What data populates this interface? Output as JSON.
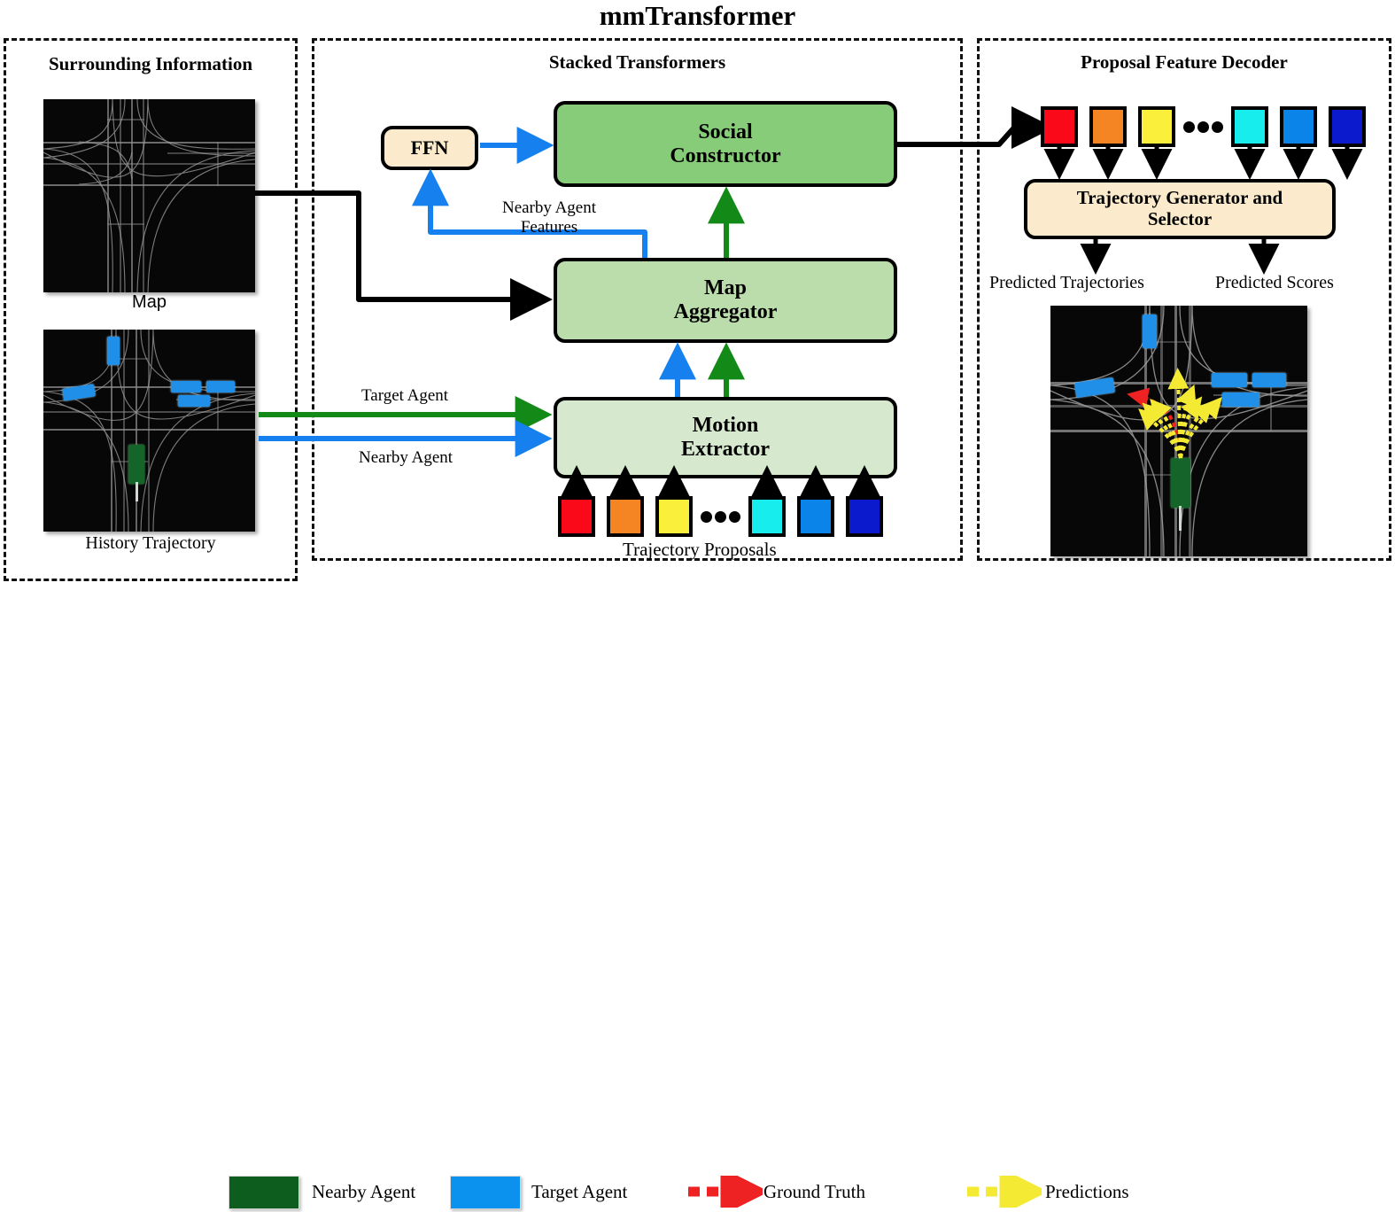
{
  "figure": {
    "title": "mmTransformer"
  },
  "panels": {
    "left": {
      "title": "Surrounding Information",
      "images": [
        {
          "caption": "Map"
        },
        {
          "caption": "History Trajectory"
        }
      ]
    },
    "middle": {
      "title": "Stacked Transformers"
    },
    "right": {
      "title": "Proposal Feature Decoder"
    }
  },
  "blocks": {
    "social_constructor": {
      "line1": "Social",
      "line2": "Constructor",
      "fill": "#87CC78"
    },
    "map_aggregator": {
      "line1": "Map",
      "line2": "Aggregator",
      "fill": "#BBDDAB"
    },
    "motion_extractor": {
      "line1": "Motion",
      "line2": "Extractor",
      "fill": "#D6E9CE"
    },
    "ffn": {
      "label": "FFN",
      "fill": "#FBEBCC"
    },
    "trajectory_generator": {
      "line1": "Trajectory Generator and",
      "line2": "Selector",
      "fill": "#FBEBCC"
    }
  },
  "edge_labels": {
    "nearby_agent_features_l1": "Nearby Agent",
    "nearby_agent_features_l2": "Features",
    "target_agent": "Target Agent",
    "nearby_agent": "Nearby Agent",
    "trajectory_proposals": "Trajectory Proposals",
    "predicted_trajectories": "Predicted Trajectories",
    "predicted_scores": "Predicted Scores"
  },
  "proposals": {
    "colors": [
      "#FA0A19",
      "#F58422",
      "#FAF03C",
      "#18EDED",
      "#0A84E8",
      "#0A1ACC"
    ],
    "ellipsis_count": 3
  },
  "legend": {
    "items": [
      {
        "label": "Nearby Agent",
        "color": "#0D5E1E",
        "style": "swatch"
      },
      {
        "label": "Target Agent",
        "color": "#0A92EE",
        "style": "swatch"
      },
      {
        "label": "Ground Truth",
        "color": "#EE2222",
        "style": "dashed-arrow"
      },
      {
        "label": "Predictions",
        "color": "#F5EA33",
        "style": "dashed-arrow"
      }
    ]
  },
  "colors": {
    "arrow_green": "#138A18",
    "arrow_blue": "#1580EE",
    "arrow_black": "#000000"
  }
}
